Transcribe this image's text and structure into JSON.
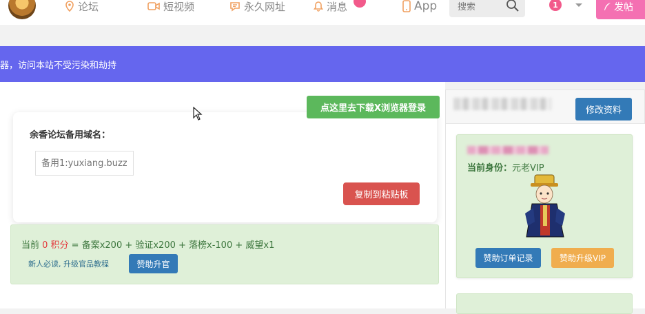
{
  "nav": {
    "items": [
      {
        "label": "论坛",
        "icon": "location-pin-icon"
      },
      {
        "label": "短视频",
        "icon": "video-camera-icon"
      },
      {
        "label": "永久网址",
        "icon": "message-icon"
      },
      {
        "label": "消息",
        "icon": "bell-icon"
      },
      {
        "label": "App",
        "icon": "mobile-phone-icon"
      }
    ],
    "message_badge": "",
    "search_placeholder": "搜索",
    "user_badge": "1",
    "post_label": "发帖"
  },
  "banner": {
    "text": "器，访问本站不受污染和劫持"
  },
  "main": {
    "download_button": "点这里去下载X浏览器登录",
    "domain_title": "余香论坛备用域名：",
    "domain_placeholder": "备用1:yuxiang.buzz",
    "copy_button": "复制到粘贴板",
    "points": {
      "prefix": "当前 ",
      "score": "0 积分",
      "formula": " = 备案x200 + 验证x200 + 落榜x-100 + 威望x1",
      "guide": "新人必读, 升级官品教程",
      "promote_button": "赞助升官"
    }
  },
  "sidebar": {
    "edit_profile_button": "修改资料",
    "identity_label": "当前身份：",
    "identity_value": "元老VIP",
    "order_button": "赞助订单记录",
    "upgrade_button": "赞助升级VIP"
  },
  "colors": {
    "banner": "#6566ee",
    "download": "#5cb85c",
    "copy": "#d9534f",
    "primary": "#337ab7",
    "warning": "#f0ad4e",
    "post": "#f470b2"
  }
}
